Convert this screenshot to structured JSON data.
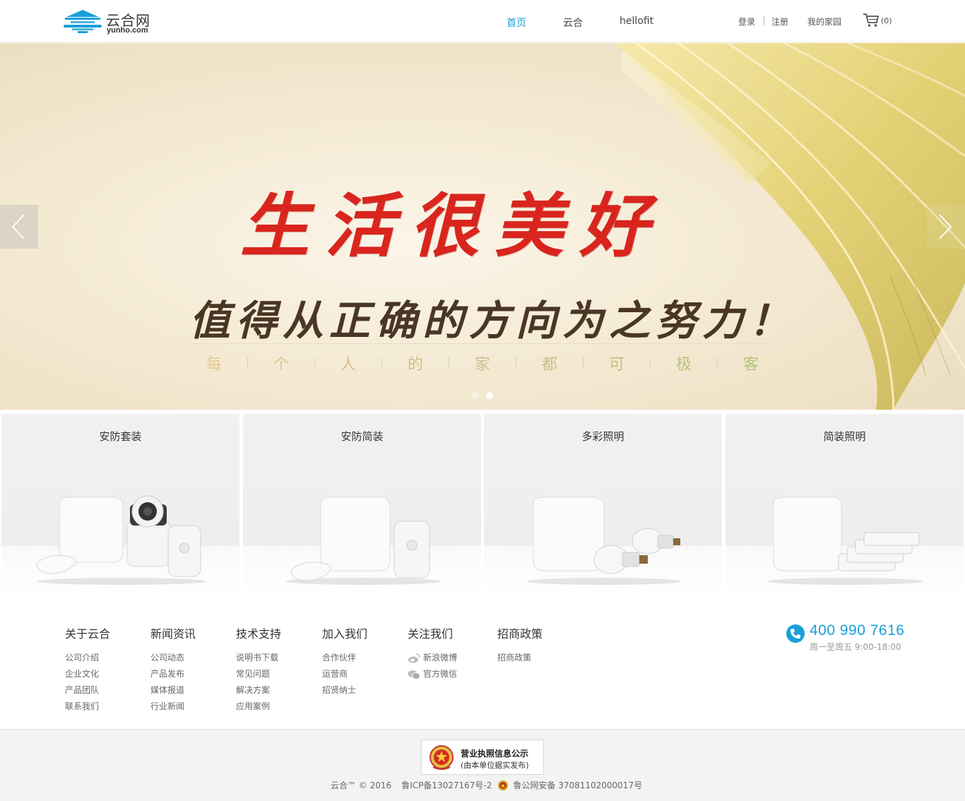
{
  "header": {
    "logo_name": "云合网",
    "logo_domain": "yunho.com",
    "nav": [
      {
        "label": "首页",
        "active": true
      },
      {
        "label": "云合",
        "active": false
      },
      {
        "label": "hellofit",
        "active": false
      }
    ],
    "login": "登录",
    "register": "注册",
    "my_home": "我的家园",
    "cart_count": "(0)"
  },
  "banner": {
    "headline": "生活很美好",
    "subline": "值得从正确的方向为之努力！",
    "tagline_chars": [
      "每",
      "个",
      "人",
      "的",
      "家",
      "都",
      "可",
      "极",
      "客"
    ],
    "tagline_colors": [
      "#e4c98f",
      "#dfc48c",
      "#d8c08a",
      "#d3bf8d",
      "#cdbf8e",
      "#c8c089",
      "#c2c082",
      "#bcc17e",
      "#b7c37b"
    ],
    "slide_count": 2,
    "active_slide": 2
  },
  "products": [
    {
      "title": "安防套装"
    },
    {
      "title": "安防简装"
    },
    {
      "title": "多彩照明"
    },
    {
      "title": "简装照明"
    }
  ],
  "footer": {
    "columns": [
      {
        "heading": "关于云合",
        "links": [
          "公司介绍",
          "企业文化",
          "产品团队",
          "联系我们"
        ]
      },
      {
        "heading": "新闻资讯",
        "links": [
          "公司动态",
          "产品发布",
          "媒体报道",
          "行业新闻"
        ]
      },
      {
        "heading": "技术支持",
        "links": [
          "说明书下载",
          "常见问题",
          "解决方案",
          "应用案例"
        ]
      },
      {
        "heading": "加入我们",
        "links": [
          "合作伙伴",
          "运营商",
          "招贤纳士"
        ]
      },
      {
        "heading": "关注我们",
        "links": [
          "新浪微博",
          "官方微信"
        ]
      },
      {
        "heading": "招商政策",
        "links": [
          "招商政策"
        ]
      }
    ],
    "phone": "400 990 7616",
    "hours": "周一至周五   9:00-18:00"
  },
  "bottom": {
    "license_title": "营业执照信息公示",
    "license_sub": "(由本单位据实发布)",
    "copyright": "云合™ © 2016",
    "icp": "鲁ICP备13027167号-2",
    "police": "鲁公网安备 37081102000017号"
  },
  "colors": {
    "accent": "#1a9fd9",
    "headline_red": "#d9251d"
  },
  "icons": [
    "logo-icon",
    "cart-icon",
    "chevron-left-icon",
    "chevron-right-icon",
    "weibo-icon",
    "wechat-icon",
    "phone-icon",
    "emblem-icon",
    "police-badge-icon"
  ]
}
